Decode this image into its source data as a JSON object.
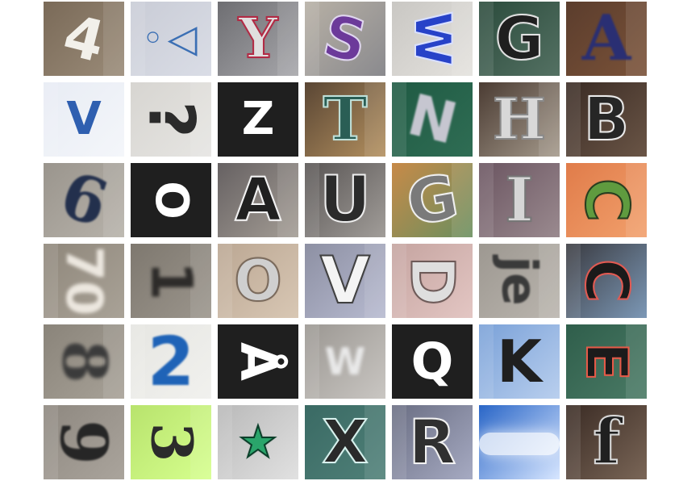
{
  "mosaic": {
    "tiles": [
      {
        "text": "4",
        "bg": "#7a6a58",
        "bg2": "#9a8b78",
        "fg": "#f2f0ea",
        "rot": 14,
        "size": 70,
        "stroke": "",
        "blur": 0,
        "serif": false
      },
      {
        "text": "◦◁",
        "bg": "#c9ccd6",
        "bg2": "#dadde6",
        "fg": "#3b6fb4",
        "rot": 0,
        "size": 48,
        "stroke": "",
        "blur": 0,
        "serif": false
      },
      {
        "text": "Y",
        "bg": "#6e6e72",
        "bg2": "#a7a7ab",
        "fg": "#e0dede",
        "rot": 0,
        "size": 68,
        "stroke": "#b22a44",
        "blur": 0,
        "serif": true
      },
      {
        "text": "S",
        "bg": "#b7b0a5",
        "bg2": "#8a8a8e",
        "fg": "#6c3a9a",
        "rot": 12,
        "size": 72,
        "stroke": "#e0d7f0",
        "blur": 0,
        "serif": false
      },
      {
        "text": "W",
        "bg": "#c9c7c3",
        "bg2": "#e4e2de",
        "fg": "#2742c8",
        "rot": 90,
        "size": 62,
        "stroke": "#d9e0ff",
        "blur": 0,
        "serif": false
      },
      {
        "text": "G",
        "bg": "#2b4b3c",
        "bg2": "#547163",
        "fg": "#1f1f1f",
        "rot": 0,
        "size": 74,
        "stroke": "#e2e2e2",
        "blur": 0,
        "serif": false
      },
      {
        "text": "A",
        "bg": "#5b3d2d",
        "bg2": "#7a5238",
        "fg": "#2a2f73",
        "rot": 0,
        "size": 78,
        "stroke": "",
        "blur": 1,
        "serif": true
      },
      {
        "text": "V",
        "bg": "#e8ecf4",
        "bg2": "#f4f6fa",
        "fg": "#2f5fb0",
        "rot": 0,
        "size": 56,
        "stroke": "",
        "blur": 0,
        "serif": false
      },
      {
        "text": "?",
        "bg": "#d7d5d1",
        "bg2": "#e6e5e2",
        "fg": "#2b2b2b",
        "rot": 90,
        "size": 78,
        "stroke": "",
        "blur": 0,
        "serif": false
      },
      {
        "text": "Z",
        "bg": "#1f1f1f",
        "bg2": "#1f1f1f",
        "fg": "#ffffff",
        "rot": 0,
        "size": 56,
        "stroke": "",
        "blur": 0,
        "serif": false
      },
      {
        "text": "T",
        "bg": "#5a4634",
        "bg2": "#b3905f",
        "fg": "#2a5e55",
        "rot": 0,
        "size": 74,
        "stroke": "#bfe0d9",
        "blur": 0,
        "serif": true
      },
      {
        "text": "N",
        "bg": "#1f5a43",
        "bg2": "#2f6d54",
        "fg": "#c6c6d0",
        "rot": 14,
        "size": 70,
        "stroke": "",
        "blur": 1,
        "serif": false
      },
      {
        "text": "H",
        "bg": "#4b3c33",
        "bg2": "#a59a8c",
        "fg": "#d8d8d8",
        "rot": 0,
        "size": 70,
        "stroke": "#8a8a8a",
        "blur": 0,
        "serif": true
      },
      {
        "text": "B",
        "bg": "#3a2b24",
        "bg2": "#6a5546",
        "fg": "#262626",
        "rot": 0,
        "size": 74,
        "stroke": "#ececec",
        "blur": 0,
        "serif": false
      },
      {
        "text": "6",
        "bg": "#9a958d",
        "bg2": "#b7b2aa",
        "fg": "#23304d",
        "rot": 18,
        "size": 78,
        "stroke": "",
        "blur": 1,
        "serif": true
      },
      {
        "text": "O",
        "bg": "#1f1f1f",
        "bg2": "#1f1f1f",
        "fg": "#ffffff",
        "rot": 90,
        "size": 56,
        "stroke": "",
        "blur": 0,
        "serif": false
      },
      {
        "text": "A",
        "bg": "#666162",
        "bg2": "#a49d95",
        "fg": "#202020",
        "rot": 0,
        "size": 74,
        "stroke": "#f3f3f3",
        "blur": 0,
        "serif": false
      },
      {
        "text": "U",
        "bg": "#595554",
        "bg2": "#a19d99",
        "fg": "#2b2b2b",
        "rot": 0,
        "size": 78,
        "stroke": "#eeeeee",
        "blur": 0,
        "serif": false
      },
      {
        "text": "G",
        "bg": "#c78a48",
        "bg2": "#6a8f5f",
        "fg": "#7a7a7a",
        "rot": -10,
        "size": 76,
        "stroke": "#f0f0f0",
        "blur": 0,
        "serif": false
      },
      {
        "text": "I",
        "bg": "#6b5561",
        "bg2": "#9a8a8f",
        "fg": "#d6d6d6",
        "rot": 0,
        "size": 76,
        "stroke": "#777777",
        "blur": 0,
        "serif": true
      },
      {
        "text": "C",
        "bg": "#e07c4a",
        "bg2": "#f2a06c",
        "fg": "#5f9b3f",
        "rot": 90,
        "size": 74,
        "stroke": "#273d1f",
        "blur": 0,
        "serif": false
      },
      {
        "text": "70",
        "bg": "#8f877b",
        "bg2": "#a9a297",
        "fg": "#ece7df",
        "rot": 90,
        "size": 62,
        "stroke": "",
        "blur": 2,
        "serif": false
      },
      {
        "text": "1",
        "bg": "#7e786f",
        "bg2": "#9b958c",
        "fg": "#2d2b29",
        "rot": 90,
        "size": 70,
        "stroke": "",
        "blur": 2,
        "serif": false
      },
      {
        "text": "O",
        "bg": "#bba793",
        "bg2": "#d8c7b4",
        "fg": "#cfcfcf",
        "rot": 0,
        "size": 70,
        "stroke": "#7a6a5c",
        "blur": 0,
        "serif": false
      },
      {
        "text": "V",
        "bg": "#8d90a3",
        "bg2": "#b7bad0",
        "fg": "#f4f4f4",
        "rot": 0,
        "size": 80,
        "stroke": "#404040",
        "blur": 0,
        "serif": false
      },
      {
        "text": "D",
        "bg": "#c5a4a0",
        "bg2": "#e3c6c3",
        "fg": "#dedede",
        "rot": 90,
        "size": 74,
        "stroke": "#6d5a58",
        "blur": 0,
        "serif": false
      },
      {
        "text": "je",
        "bg": "#9d9891",
        "bg2": "#bab5ae",
        "fg": "#3a3a3a",
        "rot": 90,
        "size": 60,
        "stroke": "",
        "blur": 1,
        "serif": false
      },
      {
        "text": "C",
        "bg": "#3a3b41",
        "bg2": "#7c98b6",
        "fg": "#1a1a1a",
        "rot": 90,
        "size": 74,
        "stroke": "#e35a52",
        "blur": 0,
        "serif": false
      },
      {
        "text": "8",
        "bg": "#8a847a",
        "bg2": "#a7a197",
        "fg": "#3b3b3b",
        "rot": 90,
        "size": 76,
        "stroke": "",
        "blur": 2,
        "serif": true
      },
      {
        "text": "2",
        "bg": "#e6e6e2",
        "bg2": "#f1f1ee",
        "fg": "#1f63b7",
        "rot": 0,
        "size": 84,
        "stroke": "",
        "blur": 1,
        "serif": false
      },
      {
        "text": "Å",
        "bg": "#1f1f1f",
        "bg2": "#1f1f1f",
        "fg": "#ffffff",
        "rot": 90,
        "size": 62,
        "stroke": "",
        "blur": 0,
        "serif": false
      },
      {
        "text": "W",
        "bg": "#9b9792",
        "bg2": "#c9c6c2",
        "fg": "#e9e9e9",
        "rot": 0,
        "size": 46,
        "stroke": "",
        "blur": 2,
        "serif": false
      },
      {
        "text": "Q",
        "bg": "#1f1f1f",
        "bg2": "#1f1f1f",
        "fg": "#ffffff",
        "rot": 0,
        "size": 62,
        "stroke": "",
        "blur": 0,
        "serif": false
      },
      {
        "text": "K",
        "bg": "#7aa1d8",
        "bg2": "#b9cfee",
        "fg": "#1f1f1f",
        "rot": 0,
        "size": 72,
        "stroke": "",
        "blur": 0,
        "serif": false
      },
      {
        "text": "E",
        "bg": "#2f5e4b",
        "bg2": "#4a7a65",
        "fg": "#1b1b1b",
        "rot": 90,
        "size": 70,
        "stroke": "#e65a48",
        "blur": 0,
        "serif": false
      },
      {
        "text": "9",
        "bg": "#8e8880",
        "bg2": "#aaa49c",
        "fg": "#262626",
        "rot": 90,
        "size": 80,
        "stroke": "",
        "blur": 1,
        "serif": true
      },
      {
        "text": "3",
        "bg": "#b8e36d",
        "bg2": "#d6ff8e",
        "fg": "#2b2b2b",
        "rot": 90,
        "size": 70,
        "stroke": "",
        "blur": 0,
        "serif": true
      },
      {
        "text": "★",
        "bg": "#b9b9b9",
        "bg2": "#e1e1e1",
        "fg": "#2aa56b",
        "rot": 0,
        "size": 54,
        "stroke": "#0b3f2a",
        "blur": 0,
        "serif": false
      },
      {
        "text": "X",
        "bg": "#3a6a64",
        "bg2": "#4f8078",
        "fg": "#2a2a2a",
        "rot": 0,
        "size": 74,
        "stroke": "#d8f2ee",
        "blur": 0,
        "serif": false
      },
      {
        "text": "R",
        "bg": "#6a6e83",
        "bg2": "#a6aac2",
        "fg": "#303030",
        "rot": 0,
        "size": 76,
        "stroke": "#f2f2f2",
        "blur": 0,
        "serif": false
      },
      {
        "text": "",
        "bg": "#2a66c7",
        "bg2": "#d7e6ff",
        "fg": "#ffffff",
        "rot": 0,
        "size": 10,
        "stroke": "",
        "blur": 0,
        "serif": false
      },
      {
        "text": "f",
        "bg": "#3a2b24",
        "bg2": "#7a6657",
        "fg": "#202020",
        "rot": 0,
        "size": 78,
        "stroke": "#d9d9d9",
        "blur": 0,
        "serif": true
      }
    ]
  }
}
